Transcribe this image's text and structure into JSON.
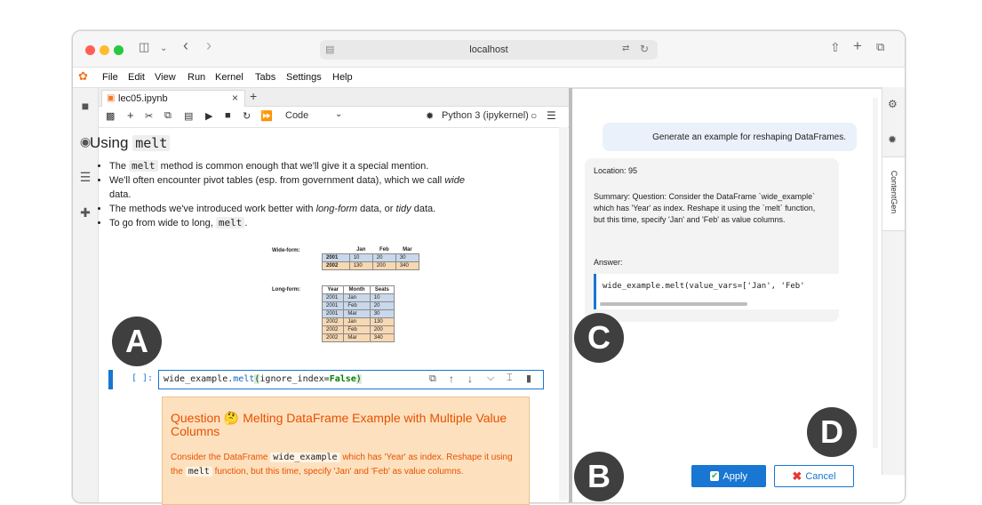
{
  "browser": {
    "url": "localhost"
  },
  "menu": [
    "File",
    "Edit",
    "View",
    "Run",
    "Kernel",
    "Tabs",
    "Settings",
    "Help"
  ],
  "notebook": {
    "tab_title": "lec05.ipynb",
    "cell_type": "Code",
    "kernel": "Python 3 (ipykernel)",
    "heading_prefix": "Using",
    "heading_code": "melt",
    "bullets": {
      "b1_pre": "The",
      "b1_code": "melt",
      "b1_post": "method is common enough that we'll give it a special mention.",
      "b2_text": "We'll often encounter pivot tables (esp. from government data), which we call",
      "b2_em": "wide",
      "b2_post": "data.",
      "b3_pre": "The methods we've introduced work better with",
      "b3_em1": "long-form",
      "b3_mid": "data, or",
      "b3_em2": "tidy",
      "b3_post": "data.",
      "b4_pre": "To go from wide to long,",
      "b4_code": "melt",
      "b4_post": "."
    },
    "wide_label": "Wide-form:",
    "wide_headers": [
      "",
      "Jan",
      "Feb",
      "Mar"
    ],
    "wide_rows": [
      [
        "2001",
        "10",
        "20",
        "30"
      ],
      [
        "2002",
        "130",
        "200",
        "340"
      ]
    ],
    "long_label": "Long-form:",
    "long_headers": [
      "Year",
      "Month",
      "Seats"
    ],
    "long_rows": [
      [
        "2001",
        "Jan",
        "10"
      ],
      [
        "2001",
        "Feb",
        "20"
      ],
      [
        "2001",
        "Mar",
        "30"
      ],
      [
        "2002",
        "Jan",
        "130"
      ],
      [
        "2002",
        "Feb",
        "200"
      ],
      [
        "2002",
        "Mar",
        "340"
      ]
    ],
    "prompt": "[ ]:",
    "code": {
      "obj": "wide_example",
      "dot": ".",
      "fn": "melt",
      "open": "(",
      "arg": "ignore_index=",
      "val": "False",
      "close": ")"
    },
    "question": {
      "title": "Question 🤔 Melting DataFrame Example with Multiple Value Columns",
      "p1": "Consider the DataFrame",
      "c1": "wide_example",
      "p2": "which has 'Year' as index. Reshape it using the",
      "c2": "melt",
      "p3": "function, but this time, specify 'Jan' and 'Feb' as value columns."
    }
  },
  "panel": {
    "user_message": "Generate an example for reshaping DataFrames.",
    "location": "Location: 95",
    "summary": "Summary: Question: Consider the DataFrame `wide_example` which has 'Year' as index. Reshape it using the `melt` function, but this time, specify 'Jan' and 'Feb' as value columns.",
    "answer_label": "Answer:",
    "answer_code": "wide_example.melt(value_vars=['Jan', 'Feb'",
    "apply_label": "Apply",
    "cancel_label": "Cancel",
    "sidebar_label": "ContentGen"
  },
  "annotations": [
    "A",
    "B",
    "C",
    "D"
  ],
  "colors": {
    "accent": "#1976d2",
    "apply_bg": "#1976d2",
    "question_bg": "#fde1bf",
    "question_text": "#e65100"
  }
}
